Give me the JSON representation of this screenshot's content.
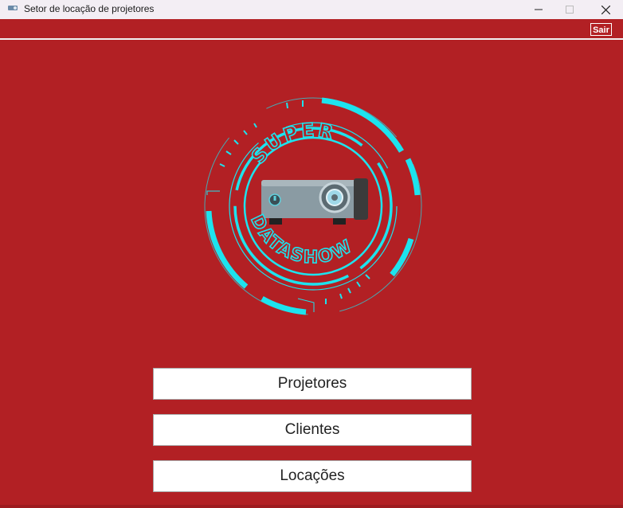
{
  "window": {
    "title": "Setor de locação de projetores",
    "controls": [
      "minimize-icon",
      "maximize-icon",
      "close-icon"
    ]
  },
  "menubar": {
    "exit_label": "Sair"
  },
  "logo": {
    "top_text": "SUPER",
    "bottom_text": "DATASHOW"
  },
  "navigation": {
    "projetores_label": "Projetores",
    "clientes_label": "Clientes",
    "locacoes_label": "Locações"
  },
  "colors": {
    "background": "#b22024",
    "logo_accent": "#1de3ee",
    "button_bg": "#ffffff"
  }
}
